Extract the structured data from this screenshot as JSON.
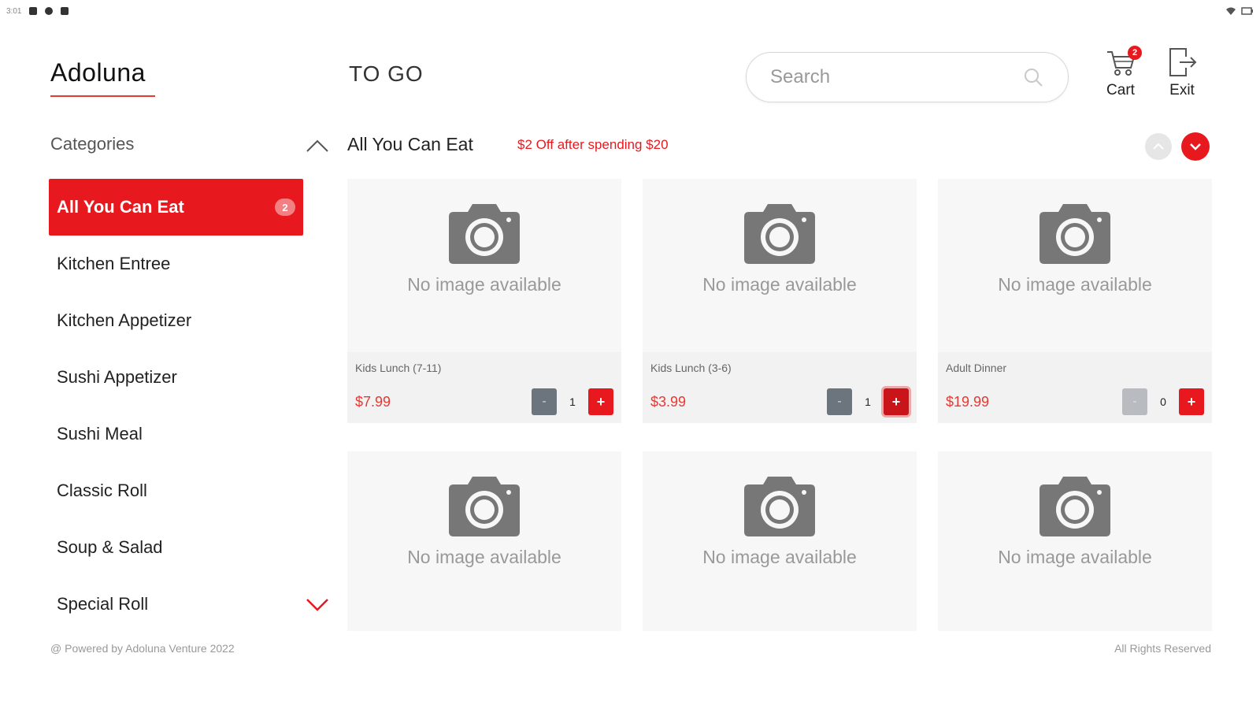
{
  "status_bar": {
    "time": "3:01"
  },
  "header": {
    "brand": "Adoluna",
    "order_type": "TO GO",
    "search": {
      "placeholder": "Search",
      "value": ""
    },
    "cart": {
      "label": "Cart",
      "count": "2"
    },
    "exit": {
      "label": "Exit"
    }
  },
  "sidebar": {
    "title": "Categories",
    "items": [
      {
        "label": "All You Can Eat",
        "badge": "2",
        "active": true
      },
      {
        "label": "Kitchen Entree"
      },
      {
        "label": "Kitchen Appetizer"
      },
      {
        "label": "Sushi Appetizer"
      },
      {
        "label": "Sushi Meal"
      },
      {
        "label": "Classic Roll"
      },
      {
        "label": "Soup & Salad"
      },
      {
        "label": "Special Roll"
      }
    ]
  },
  "content": {
    "section_title": "All You Can Eat",
    "promo": "$2 Off after spending $20",
    "no_image_text": "No image available",
    "items": [
      {
        "name": "Kids Lunch (7-11)",
        "price": "$7.99",
        "qty": "1",
        "minus": "-",
        "plus": "+"
      },
      {
        "name": "Kids Lunch (3-6)",
        "price": "$3.99",
        "qty": "1",
        "minus": "-",
        "plus": "+"
      },
      {
        "name": "Adult Dinner",
        "price": "$19.99",
        "qty": "0",
        "minus": "-",
        "plus": "+"
      },
      {
        "no_info": true
      },
      {
        "no_info": true
      },
      {
        "no_info": true
      }
    ]
  },
  "footer": {
    "left": "@ Powered by Adoluna Venture 2022",
    "right": "All Rights Reserved"
  },
  "colors": {
    "accent": "#e8191e",
    "minus_button": "#6c757d",
    "card_bg": "#f7f7f7"
  }
}
